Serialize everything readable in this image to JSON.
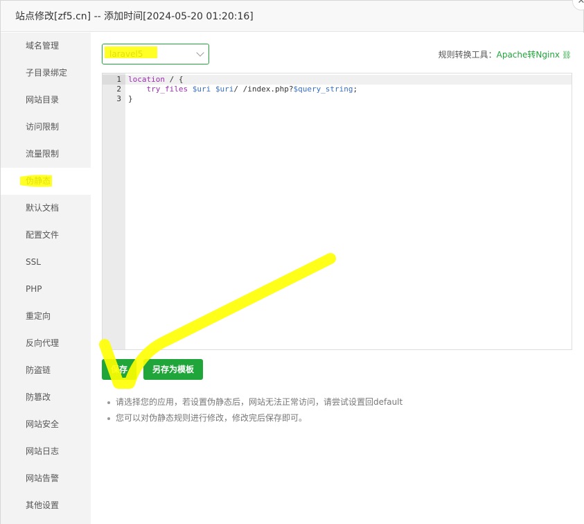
{
  "window": {
    "title": "站点修改[zf5.cn] -- 添加时间[2024-05-20 01:20:16]",
    "close_glyph": "✕"
  },
  "sidebar": {
    "items": [
      {
        "label": "域名管理"
      },
      {
        "label": "子目录绑定"
      },
      {
        "label": "网站目录"
      },
      {
        "label": "访问限制"
      },
      {
        "label": "流量限制"
      },
      {
        "label": "伪静态",
        "active": true
      },
      {
        "label": "默认文档"
      },
      {
        "label": "配置文件"
      },
      {
        "label": "SSL"
      },
      {
        "label": "PHP"
      },
      {
        "label": "重定向"
      },
      {
        "label": "反向代理"
      },
      {
        "label": "防盗链"
      },
      {
        "label": "防篡改"
      },
      {
        "label": "网站安全"
      },
      {
        "label": "网站日志"
      },
      {
        "label": "网站告警"
      },
      {
        "label": "其他设置"
      }
    ]
  },
  "rewrite": {
    "template_select": {
      "value": "laravel5"
    },
    "converter": {
      "label": "规则转换工具：",
      "link": "Apache转Nginx",
      "icon": "link-icon"
    },
    "editor": {
      "line_numbers": [
        "1",
        "2",
        "3"
      ],
      "lines": [
        {
          "kw": "location",
          "rest": " / {"
        },
        {
          "indent": "    ",
          "kw": "try_files",
          "v1": "$uri",
          "v2": "$uri",
          "mid": "/ /index.php?",
          "v3": "$query_string",
          "end": ";"
        },
        {
          "rest": "}"
        }
      ]
    },
    "buttons": {
      "save": "保存",
      "save_as_template": "另存为模板"
    },
    "tips": [
      "请选择您的应用，若设置伪静态后，网站无法正常访问，请尝试设置回default",
      "您可以对伪静态规则进行修改，修改完后保存即可。"
    ]
  },
  "colors": {
    "accent": "#20a53a",
    "highlighter": "#ffff00",
    "sidebar_bg": "#f3f3f3"
  }
}
